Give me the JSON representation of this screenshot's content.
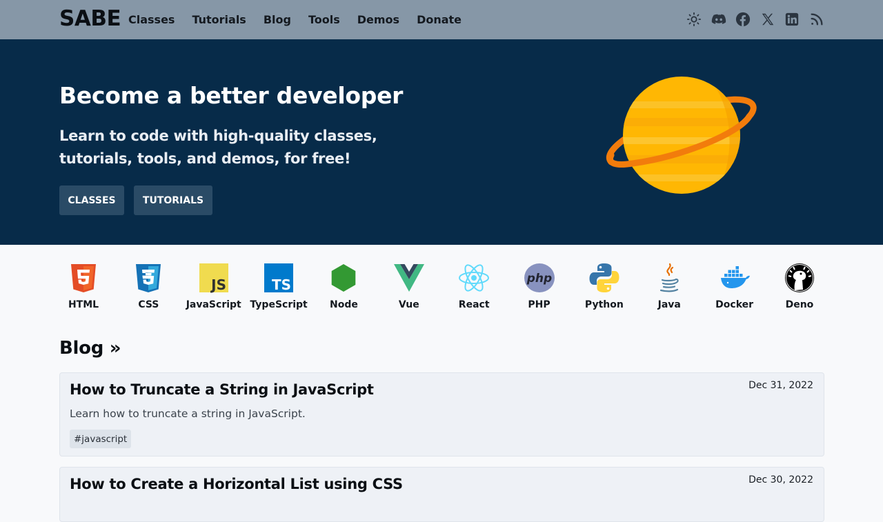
{
  "header": {
    "brand": "SABE",
    "nav": [
      "Classes",
      "Tutorials",
      "Blog",
      "Tools",
      "Demos",
      "Donate"
    ],
    "icons": [
      "sun-icon",
      "discord-icon",
      "facebook-icon",
      "x-icon",
      "linkedin-icon",
      "rss-icon"
    ]
  },
  "hero": {
    "title": "Become a better developer",
    "subtitle": "Learn to code with high-quality classes, tutorials, tools, and demos, for free!",
    "buttons": [
      "CLASSES",
      "TUTORIALS"
    ]
  },
  "techs": [
    "HTML",
    "CSS",
    "JavaScript",
    "TypeScript",
    "Node",
    "Vue",
    "React",
    "PHP",
    "Python",
    "Java",
    "Docker",
    "Deno"
  ],
  "blog": {
    "heading": "Blog »",
    "posts": [
      {
        "title": "How to Truncate a String in JavaScript",
        "date": "Dec 31, 2022",
        "description": "Learn how to truncate a string in JavaScript.",
        "tag": "#javascript"
      },
      {
        "title": "How to Create a Horizontal List using CSS",
        "date": "Dec 30, 2022"
      }
    ]
  },
  "colors": {
    "topbar": "#8697a7",
    "hero": "#072b49",
    "button": "#2a4b66",
    "card": "#eef1f6"
  }
}
